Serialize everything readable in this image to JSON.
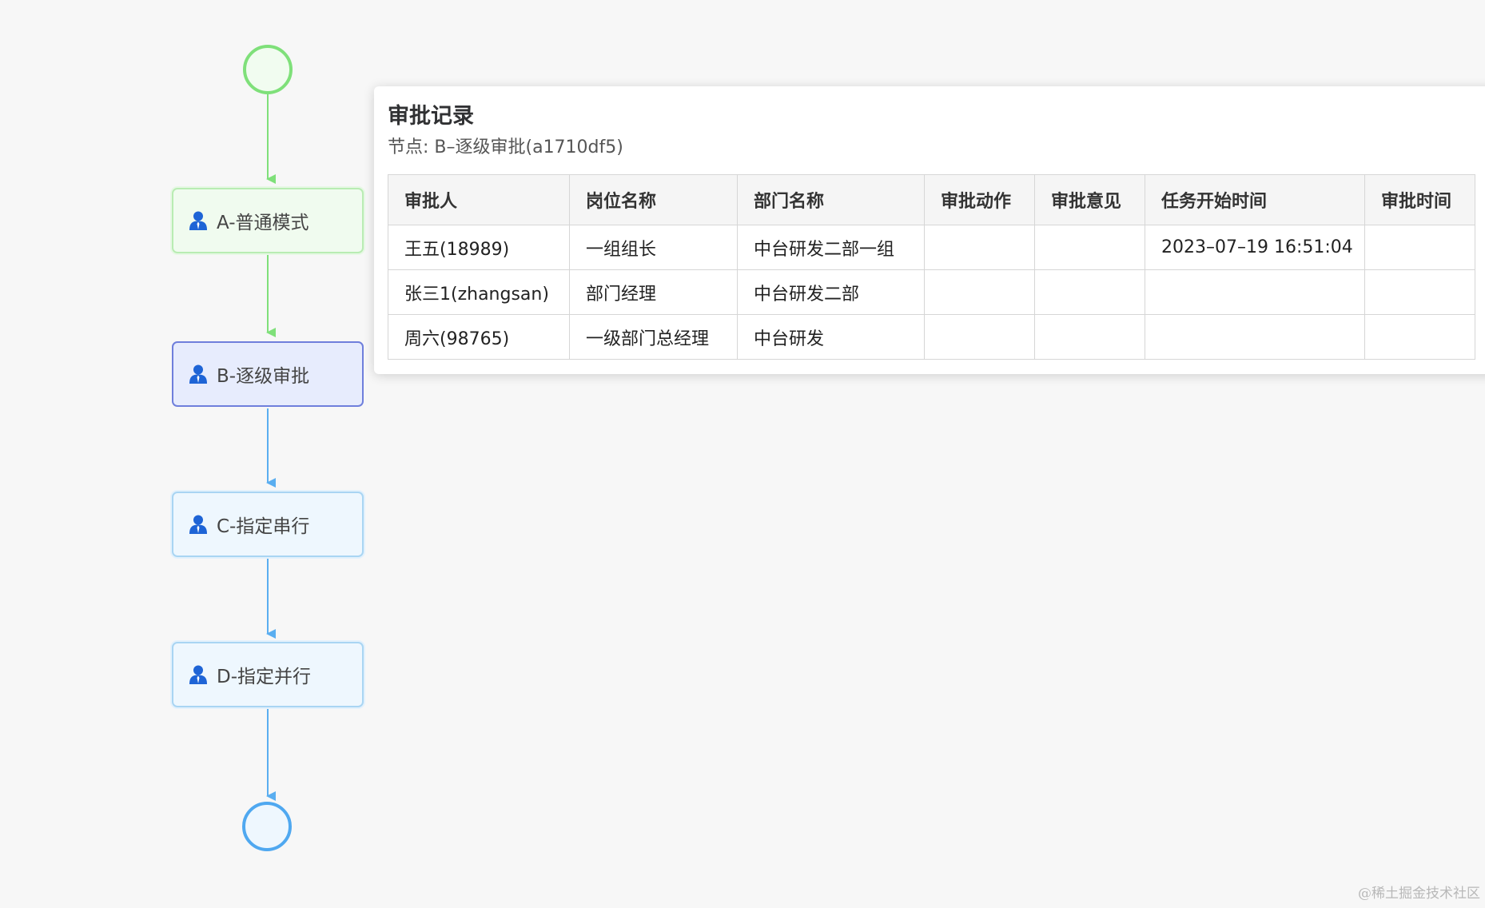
{
  "colors": {
    "background": "#f7f7f7",
    "done_green": "#7fe07a",
    "active_purple": "#6f7fdc",
    "todo_blue": "#5aaef0",
    "end_blue": "#4fa8f0",
    "user_icon_blue": "#1e64d6"
  },
  "flow": {
    "start_event": {
      "state": "done"
    },
    "end_event": {
      "state": "todo"
    },
    "nodes": [
      {
        "label": "A-普通模式",
        "state": "done",
        "icon": "user-icon"
      },
      {
        "label": "B-逐级审批",
        "state": "active",
        "icon": "user-icon"
      },
      {
        "label": "C-指定串行",
        "state": "todo",
        "icon": "user-icon"
      },
      {
        "label": "D-指定并行",
        "state": "todo",
        "icon": "user-icon"
      }
    ]
  },
  "popup": {
    "title": "审批记录",
    "subtitle": "节点: B–逐级审批(a1710df5)",
    "columns": [
      "审批人",
      "岗位名称",
      "部门名称",
      "审批动作",
      "审批意见",
      "任务开始时间",
      "审批时间"
    ],
    "rows": [
      [
        "王五(18989)",
        "一组组长",
        "中台研发二部一组",
        "",
        "",
        "2023–07–19 16:51:04",
        ""
      ],
      [
        "张三1(zhangsan)",
        "部门经理",
        "中台研发二部",
        "",
        "",
        "",
        ""
      ],
      [
        "周六(98765)",
        "一级部门总经理",
        "中台研发",
        "",
        "",
        "",
        ""
      ]
    ]
  },
  "watermark": "@稀土掘金技术社区"
}
